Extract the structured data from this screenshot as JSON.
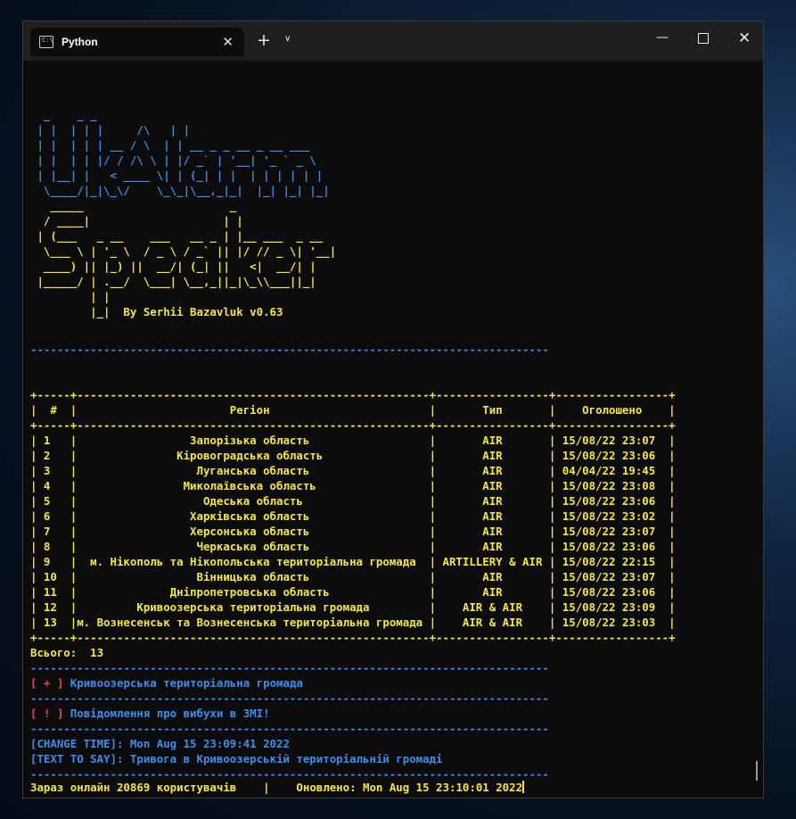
{
  "tab": {
    "title": "Python",
    "icon": "terminal-icon"
  },
  "banner": {
    "ukr_alarm_art": [
      "  _    _ _              ",
      " | |  | | |     /\\   | |",
      " | |  | | | __ / \\  | | __ _ _ __ _ __ ___",
      " | |  | | |/ / /\\ \\ | |/ _` | '__| '_ ` _ \\",
      " | |__| |   < ____ \\| | (_| | |  | | | | | |",
      "  \\____/|_|\\_\\/    \\_\\_|\\__,_|_|  |_| |_| |_|"
    ],
    "sysapp_art": [
      "   _____                      _",
      "  / ____|                    | |",
      " | (___   _ __    ___   __ _ | |__ ___  _ __",
      "  \\___ \\ | '_ \\  / _ \\ / _` || |/ // _ \\| '__|",
      "  ____) || |_) ||  __/| (_| ||   <|  __/| |",
      " |_____/ | .__/  \\___| \\__,_||_|\\_\\\\___||_|",
      "         | |",
      "         |_|  By Serhii Bazavluk v0.63"
    ]
  },
  "separator": "------------------------------------------------------------------------------",
  "table": {
    "border": "+-----+-----------------------------------------------------+-----------------+-----------------+",
    "headers": {
      "num": "#",
      "region": "Регіон",
      "type": "Тип",
      "announced": "Оголошено"
    },
    "rows": [
      {
        "num": "1",
        "region": "Запорізька область",
        "type": "AIR",
        "announced": "15/08/22 23:07"
      },
      {
        "num": "2",
        "region": "Кіровоградська область",
        "type": "AIR",
        "announced": "15/08/22 23:06"
      },
      {
        "num": "3",
        "region": "Луганська область",
        "type": "AIR",
        "announced": "04/04/22 19:45"
      },
      {
        "num": "4",
        "region": "Миколаївська область",
        "type": "AIR",
        "announced": "15/08/22 23:08"
      },
      {
        "num": "5",
        "region": "Одеська область",
        "type": "AIR",
        "announced": "15/08/22 23:06"
      },
      {
        "num": "6",
        "region": "Харківська область",
        "type": "AIR",
        "announced": "15/08/22 23:02"
      },
      {
        "num": "7",
        "region": "Херсонська область",
        "type": "AIR",
        "announced": "15/08/22 23:07"
      },
      {
        "num": "8",
        "region": "Черкаська область",
        "type": "AIR",
        "announced": "15/08/22 23:06"
      },
      {
        "num": "9",
        "region": "м. Нікополь та Нікопольська територіальна громада",
        "type": "ARTILLERY & AIR",
        "announced": "15/08/22 22:15"
      },
      {
        "num": "10",
        "region": "Вінницька область",
        "type": "AIR",
        "announced": "15/08/22 23:07"
      },
      {
        "num": "11",
        "region": "Дніпропетровська область",
        "type": "AIR",
        "announced": "15/08/22 23:06"
      },
      {
        "num": "12",
        "region": "Кривоозерська територіальна громада",
        "type": "AIR & AIR",
        "announced": "15/08/22 23:09"
      },
      {
        "num": "13",
        "region": "м. Вознесенськ та Вознесенська територіальна громада",
        "type": "AIR & AIR",
        "announced": "15/08/22 23:03"
      }
    ],
    "total_label": "Всього:",
    "total_value": "13"
  },
  "events": {
    "added_marker": "[ + ]",
    "added_text": "Кривоозерська територіальна громада",
    "alert_marker": "[ ! ]",
    "alert_text": "Повідомлення про вибухи в ЗМІ!",
    "change_time": "[CHANGE TIME]: Mon Aug 15 23:09:41 2022",
    "text_to_say": "[TEXT TO SAY]: Тривога в Кривоозерській територіальній громаді"
  },
  "status": {
    "online": "Зараз онлайн 20869 користувачів",
    "divider": "|",
    "updated": "Оновлено: Mon Aug 15 23:10:01 2022"
  },
  "colors": {
    "yellow": "#f5e642",
    "blue": "#3b8eea",
    "red": "#e74856"
  }
}
